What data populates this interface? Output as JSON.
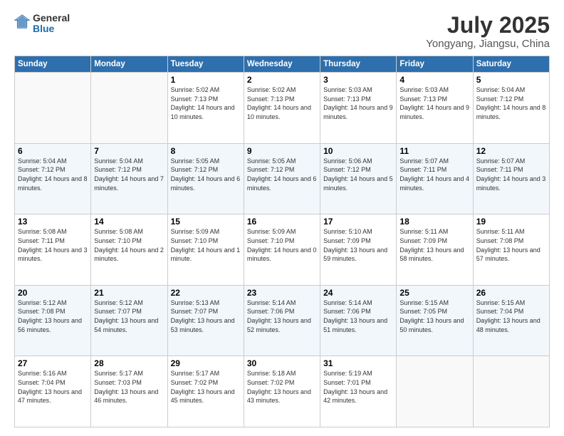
{
  "logo": {
    "general": "General",
    "blue": "Blue"
  },
  "title": "July 2025",
  "subtitle": "Yongyang, Jiangsu, China",
  "weekdays": [
    "Sunday",
    "Monday",
    "Tuesday",
    "Wednesday",
    "Thursday",
    "Friday",
    "Saturday"
  ],
  "weeks": [
    [
      {
        "day": "",
        "sunrise": "",
        "sunset": "",
        "daylight": ""
      },
      {
        "day": "",
        "sunrise": "",
        "sunset": "",
        "daylight": ""
      },
      {
        "day": "1",
        "sunrise": "Sunrise: 5:02 AM",
        "sunset": "Sunset: 7:13 PM",
        "daylight": "Daylight: 14 hours and 10 minutes."
      },
      {
        "day": "2",
        "sunrise": "Sunrise: 5:02 AM",
        "sunset": "Sunset: 7:13 PM",
        "daylight": "Daylight: 14 hours and 10 minutes."
      },
      {
        "day": "3",
        "sunrise": "Sunrise: 5:03 AM",
        "sunset": "Sunset: 7:13 PM",
        "daylight": "Daylight: 14 hours and 9 minutes."
      },
      {
        "day": "4",
        "sunrise": "Sunrise: 5:03 AM",
        "sunset": "Sunset: 7:13 PM",
        "daylight": "Daylight: 14 hours and 9 minutes."
      },
      {
        "day": "5",
        "sunrise": "Sunrise: 5:04 AM",
        "sunset": "Sunset: 7:12 PM",
        "daylight": "Daylight: 14 hours and 8 minutes."
      }
    ],
    [
      {
        "day": "6",
        "sunrise": "Sunrise: 5:04 AM",
        "sunset": "Sunset: 7:12 PM",
        "daylight": "Daylight: 14 hours and 8 minutes."
      },
      {
        "day": "7",
        "sunrise": "Sunrise: 5:04 AM",
        "sunset": "Sunset: 7:12 PM",
        "daylight": "Daylight: 14 hours and 7 minutes."
      },
      {
        "day": "8",
        "sunrise": "Sunrise: 5:05 AM",
        "sunset": "Sunset: 7:12 PM",
        "daylight": "Daylight: 14 hours and 6 minutes."
      },
      {
        "day": "9",
        "sunrise": "Sunrise: 5:05 AM",
        "sunset": "Sunset: 7:12 PM",
        "daylight": "Daylight: 14 hours and 6 minutes."
      },
      {
        "day": "10",
        "sunrise": "Sunrise: 5:06 AM",
        "sunset": "Sunset: 7:12 PM",
        "daylight": "Daylight: 14 hours and 5 minutes."
      },
      {
        "day": "11",
        "sunrise": "Sunrise: 5:07 AM",
        "sunset": "Sunset: 7:11 PM",
        "daylight": "Daylight: 14 hours and 4 minutes."
      },
      {
        "day": "12",
        "sunrise": "Sunrise: 5:07 AM",
        "sunset": "Sunset: 7:11 PM",
        "daylight": "Daylight: 14 hours and 3 minutes."
      }
    ],
    [
      {
        "day": "13",
        "sunrise": "Sunrise: 5:08 AM",
        "sunset": "Sunset: 7:11 PM",
        "daylight": "Daylight: 14 hours and 3 minutes."
      },
      {
        "day": "14",
        "sunrise": "Sunrise: 5:08 AM",
        "sunset": "Sunset: 7:10 PM",
        "daylight": "Daylight: 14 hours and 2 minutes."
      },
      {
        "day": "15",
        "sunrise": "Sunrise: 5:09 AM",
        "sunset": "Sunset: 7:10 PM",
        "daylight": "Daylight: 14 hours and 1 minute."
      },
      {
        "day": "16",
        "sunrise": "Sunrise: 5:09 AM",
        "sunset": "Sunset: 7:10 PM",
        "daylight": "Daylight: 14 hours and 0 minutes."
      },
      {
        "day": "17",
        "sunrise": "Sunrise: 5:10 AM",
        "sunset": "Sunset: 7:09 PM",
        "daylight": "Daylight: 13 hours and 59 minutes."
      },
      {
        "day": "18",
        "sunrise": "Sunrise: 5:11 AM",
        "sunset": "Sunset: 7:09 PM",
        "daylight": "Daylight: 13 hours and 58 minutes."
      },
      {
        "day": "19",
        "sunrise": "Sunrise: 5:11 AM",
        "sunset": "Sunset: 7:08 PM",
        "daylight": "Daylight: 13 hours and 57 minutes."
      }
    ],
    [
      {
        "day": "20",
        "sunrise": "Sunrise: 5:12 AM",
        "sunset": "Sunset: 7:08 PM",
        "daylight": "Daylight: 13 hours and 56 minutes."
      },
      {
        "day": "21",
        "sunrise": "Sunrise: 5:12 AM",
        "sunset": "Sunset: 7:07 PM",
        "daylight": "Daylight: 13 hours and 54 minutes."
      },
      {
        "day": "22",
        "sunrise": "Sunrise: 5:13 AM",
        "sunset": "Sunset: 7:07 PM",
        "daylight": "Daylight: 13 hours and 53 minutes."
      },
      {
        "day": "23",
        "sunrise": "Sunrise: 5:14 AM",
        "sunset": "Sunset: 7:06 PM",
        "daylight": "Daylight: 13 hours and 52 minutes."
      },
      {
        "day": "24",
        "sunrise": "Sunrise: 5:14 AM",
        "sunset": "Sunset: 7:06 PM",
        "daylight": "Daylight: 13 hours and 51 minutes."
      },
      {
        "day": "25",
        "sunrise": "Sunrise: 5:15 AM",
        "sunset": "Sunset: 7:05 PM",
        "daylight": "Daylight: 13 hours and 50 minutes."
      },
      {
        "day": "26",
        "sunrise": "Sunrise: 5:15 AM",
        "sunset": "Sunset: 7:04 PM",
        "daylight": "Daylight: 13 hours and 48 minutes."
      }
    ],
    [
      {
        "day": "27",
        "sunrise": "Sunrise: 5:16 AM",
        "sunset": "Sunset: 7:04 PM",
        "daylight": "Daylight: 13 hours and 47 minutes."
      },
      {
        "day": "28",
        "sunrise": "Sunrise: 5:17 AM",
        "sunset": "Sunset: 7:03 PM",
        "daylight": "Daylight: 13 hours and 46 minutes."
      },
      {
        "day": "29",
        "sunrise": "Sunrise: 5:17 AM",
        "sunset": "Sunset: 7:02 PM",
        "daylight": "Daylight: 13 hours and 45 minutes."
      },
      {
        "day": "30",
        "sunrise": "Sunrise: 5:18 AM",
        "sunset": "Sunset: 7:02 PM",
        "daylight": "Daylight: 13 hours and 43 minutes."
      },
      {
        "day": "31",
        "sunrise": "Sunrise: 5:19 AM",
        "sunset": "Sunset: 7:01 PM",
        "daylight": "Daylight: 13 hours and 42 minutes."
      },
      {
        "day": "",
        "sunrise": "",
        "sunset": "",
        "daylight": ""
      },
      {
        "day": "",
        "sunrise": "",
        "sunset": "",
        "daylight": ""
      }
    ]
  ]
}
